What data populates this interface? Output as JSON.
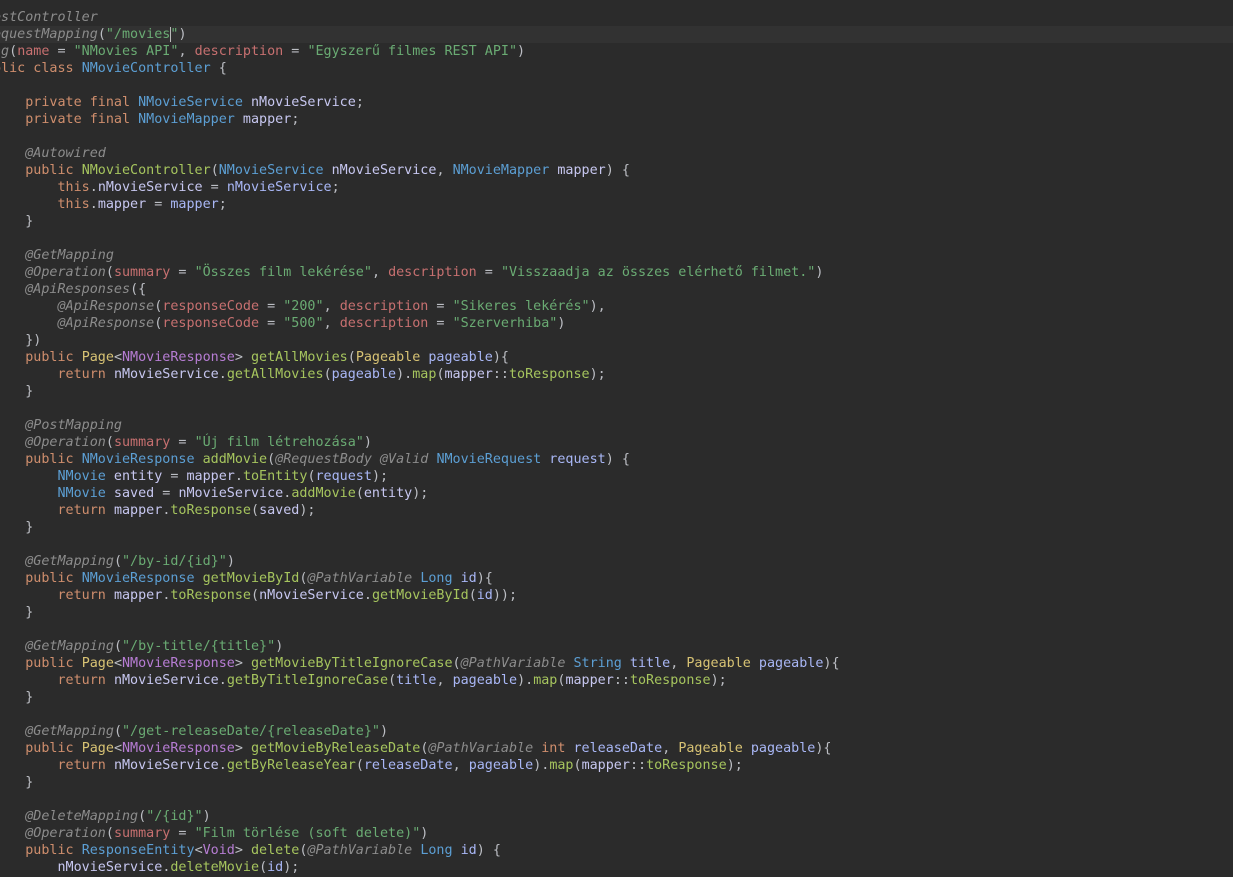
{
  "editor": {
    "language": "java",
    "cursor_line": 2,
    "cursor_col": 22,
    "lines": [
      [
        [
          "ann",
          "estController"
        ]
      ],
      [
        [
          "ann",
          "equestMapping"
        ],
        [
          "punc",
          "("
        ],
        [
          "str",
          "\"/movies\""
        ],
        [
          "punc",
          ")"
        ]
      ],
      [
        [
          "ann",
          "ag"
        ],
        [
          "punc",
          "("
        ],
        [
          "attr",
          "name"
        ],
        [
          "punc",
          " = "
        ],
        [
          "str",
          "\"NMovies API\""
        ],
        [
          "punc",
          ", "
        ],
        [
          "attr",
          "description"
        ],
        [
          "punc",
          " = "
        ],
        [
          "str",
          "\"Egyszerű filmes REST API\""
        ],
        [
          "punc",
          ")"
        ]
      ],
      [
        [
          "kw",
          "blic class "
        ],
        [
          "cls",
          "NMovieController"
        ],
        [
          "punc",
          " {"
        ]
      ],
      [],
      [
        [
          "kw",
          "    private final "
        ],
        [
          "cls",
          "NMovieService"
        ],
        [
          "id",
          " nMovieService"
        ],
        [
          "punc",
          ";"
        ]
      ],
      [
        [
          "kw",
          "    private final "
        ],
        [
          "cls",
          "NMovieMapper"
        ],
        [
          "id",
          " mapper"
        ],
        [
          "punc",
          ";"
        ]
      ],
      [],
      [
        [
          "ann",
          "    @Autowired"
        ]
      ],
      [
        [
          "kw",
          "    public "
        ],
        [
          "call",
          "NMovieController"
        ],
        [
          "punc",
          "("
        ],
        [
          "cls",
          "NMovieService"
        ],
        [
          "id",
          " nMovieService"
        ],
        [
          "punc",
          ", "
        ],
        [
          "cls",
          "NMovieMapper"
        ],
        [
          "id",
          " mapper"
        ],
        [
          "punc",
          ") {"
        ]
      ],
      [
        [
          "kw",
          "        this"
        ],
        [
          "punc",
          "."
        ],
        [
          "id",
          "nMovieService"
        ],
        [
          "punc",
          " = "
        ],
        [
          "param",
          "nMovieService"
        ],
        [
          "punc",
          ";"
        ]
      ],
      [
        [
          "kw",
          "        this"
        ],
        [
          "punc",
          "."
        ],
        [
          "id",
          "mapper"
        ],
        [
          "punc",
          " = "
        ],
        [
          "param",
          "mapper"
        ],
        [
          "punc",
          ";"
        ]
      ],
      [
        [
          "punc",
          "    }"
        ]
      ],
      [],
      [
        [
          "ann",
          "    @GetMapping"
        ]
      ],
      [
        [
          "ann",
          "    @Operation"
        ],
        [
          "punc",
          "("
        ],
        [
          "attr",
          "summary"
        ],
        [
          "punc",
          " = "
        ],
        [
          "str",
          "\"Összes film lekérése\""
        ],
        [
          "punc",
          ", "
        ],
        [
          "attr",
          "description"
        ],
        [
          "punc",
          " = "
        ],
        [
          "str",
          "\"Visszaadja az összes elérhető filmet.\""
        ],
        [
          "punc",
          ")"
        ]
      ],
      [
        [
          "ann",
          "    @ApiResponses"
        ],
        [
          "punc",
          "({"
        ]
      ],
      [
        [
          "ann",
          "        @ApiResponse"
        ],
        [
          "punc",
          "("
        ],
        [
          "attr",
          "responseCode"
        ],
        [
          "punc",
          " = "
        ],
        [
          "str",
          "\"200\""
        ],
        [
          "punc",
          ", "
        ],
        [
          "attr",
          "description"
        ],
        [
          "punc",
          " = "
        ],
        [
          "str",
          "\"Sikeres lekérés\""
        ],
        [
          "punc",
          "),"
        ]
      ],
      [
        [
          "ann",
          "        @ApiResponse"
        ],
        [
          "punc",
          "("
        ],
        [
          "attr",
          "responseCode"
        ],
        [
          "punc",
          " = "
        ],
        [
          "str",
          "\"500\""
        ],
        [
          "punc",
          ", "
        ],
        [
          "attr",
          "description"
        ],
        [
          "punc",
          " = "
        ],
        [
          "str",
          "\"Szerverhiba\""
        ],
        [
          "punc",
          ")"
        ]
      ],
      [
        [
          "punc",
          "    })"
        ]
      ],
      [
        [
          "kw",
          "    public "
        ],
        [
          "plain",
          "Page"
        ],
        [
          "punc",
          "<"
        ],
        [
          "gen",
          "NMovieResponse"
        ],
        [
          "punc",
          "> "
        ],
        [
          "call",
          "getAllMovies"
        ],
        [
          "punc",
          "("
        ],
        [
          "plain",
          "Pageable"
        ],
        [
          "param",
          " pageable"
        ],
        [
          "punc",
          "){"
        ]
      ],
      [
        [
          "kw",
          "        return "
        ],
        [
          "id",
          "nMovieService"
        ],
        [
          "punc",
          "."
        ],
        [
          "call",
          "getAllMovies"
        ],
        [
          "punc",
          "("
        ],
        [
          "param",
          "pageable"
        ],
        [
          "punc",
          ")."
        ],
        [
          "call",
          "map"
        ],
        [
          "punc",
          "("
        ],
        [
          "id",
          "mapper"
        ],
        [
          "punc",
          "::"
        ],
        [
          "call",
          "toResponse"
        ],
        [
          "punc",
          ");"
        ]
      ],
      [
        [
          "punc",
          "    }"
        ]
      ],
      [],
      [
        [
          "ann",
          "    @PostMapping"
        ]
      ],
      [
        [
          "ann",
          "    @Operation"
        ],
        [
          "punc",
          "("
        ],
        [
          "attr",
          "summary"
        ],
        [
          "punc",
          " = "
        ],
        [
          "str",
          "\"Új film létrehozása\""
        ],
        [
          "punc",
          ")"
        ]
      ],
      [
        [
          "kw",
          "    public "
        ],
        [
          "cls",
          "NMovieResponse"
        ],
        [
          "call",
          " addMovie"
        ],
        [
          "punc",
          "("
        ],
        [
          "ann",
          "@RequestBody @Valid "
        ],
        [
          "cls",
          "NMovieRequest"
        ],
        [
          "param",
          " request"
        ],
        [
          "punc",
          ") {"
        ]
      ],
      [
        [
          "cls",
          "        NMovie"
        ],
        [
          "id",
          " entity"
        ],
        [
          "punc",
          " = "
        ],
        [
          "id",
          "mapper"
        ],
        [
          "punc",
          "."
        ],
        [
          "call",
          "toEntity"
        ],
        [
          "punc",
          "("
        ],
        [
          "param",
          "request"
        ],
        [
          "punc",
          ");"
        ]
      ],
      [
        [
          "cls",
          "        NMovie"
        ],
        [
          "id",
          " saved"
        ],
        [
          "punc",
          " = "
        ],
        [
          "id",
          "nMovieService"
        ],
        [
          "punc",
          "."
        ],
        [
          "call",
          "addMovie"
        ],
        [
          "punc",
          "("
        ],
        [
          "id",
          "entity"
        ],
        [
          "punc",
          ");"
        ]
      ],
      [
        [
          "kw",
          "        return "
        ],
        [
          "id",
          "mapper"
        ],
        [
          "punc",
          "."
        ],
        [
          "call",
          "toResponse"
        ],
        [
          "punc",
          "("
        ],
        [
          "id",
          "saved"
        ],
        [
          "punc",
          ");"
        ]
      ],
      [
        [
          "punc",
          "    }"
        ]
      ],
      [],
      [
        [
          "ann",
          "    @GetMapping"
        ],
        [
          "punc",
          "("
        ],
        [
          "str",
          "\"/by-id/{id}\""
        ],
        [
          "punc",
          ")"
        ]
      ],
      [
        [
          "kw",
          "    public "
        ],
        [
          "cls",
          "NMovieResponse"
        ],
        [
          "call",
          " getMovieById"
        ],
        [
          "punc",
          "("
        ],
        [
          "ann",
          "@PathVariable "
        ],
        [
          "cls",
          "Long"
        ],
        [
          "param",
          " id"
        ],
        [
          "punc",
          "){"
        ]
      ],
      [
        [
          "kw",
          "        return "
        ],
        [
          "id",
          "mapper"
        ],
        [
          "punc",
          "."
        ],
        [
          "call",
          "toResponse"
        ],
        [
          "punc",
          "("
        ],
        [
          "id",
          "nMovieService"
        ],
        [
          "punc",
          "."
        ],
        [
          "call",
          "getMovieById"
        ],
        [
          "punc",
          "("
        ],
        [
          "param",
          "id"
        ],
        [
          "punc",
          "));"
        ]
      ],
      [
        [
          "punc",
          "    }"
        ]
      ],
      [],
      [
        [
          "ann",
          "    @GetMapping"
        ],
        [
          "punc",
          "("
        ],
        [
          "str",
          "\"/by-title/{title}\""
        ],
        [
          "punc",
          ")"
        ]
      ],
      [
        [
          "kw",
          "    public "
        ],
        [
          "plain",
          "Page"
        ],
        [
          "punc",
          "<"
        ],
        [
          "gen",
          "NMovieResponse"
        ],
        [
          "punc",
          "> "
        ],
        [
          "call",
          "getMovieByTitleIgnoreCase"
        ],
        [
          "punc",
          "("
        ],
        [
          "ann",
          "@PathVariable "
        ],
        [
          "cls",
          "String"
        ],
        [
          "param",
          " title"
        ],
        [
          "punc",
          ", "
        ],
        [
          "plain",
          "Pageable"
        ],
        [
          "param",
          " pageable"
        ],
        [
          "punc",
          "){"
        ]
      ],
      [
        [
          "kw",
          "        return "
        ],
        [
          "id",
          "nMovieService"
        ],
        [
          "punc",
          "."
        ],
        [
          "call",
          "getByTitleIgnoreCase"
        ],
        [
          "punc",
          "("
        ],
        [
          "param",
          "title"
        ],
        [
          "punc",
          ", "
        ],
        [
          "param",
          "pageable"
        ],
        [
          "punc",
          ")."
        ],
        [
          "call",
          "map"
        ],
        [
          "punc",
          "("
        ],
        [
          "id",
          "mapper"
        ],
        [
          "punc",
          "::"
        ],
        [
          "call",
          "toResponse"
        ],
        [
          "punc",
          ");"
        ]
      ],
      [
        [
          "punc",
          "    }"
        ]
      ],
      [],
      [
        [
          "ann",
          "    @GetMapping"
        ],
        [
          "punc",
          "("
        ],
        [
          "str",
          "\"/get-releaseDate/{releaseDate}\""
        ],
        [
          "punc",
          ")"
        ]
      ],
      [
        [
          "kw",
          "    public "
        ],
        [
          "plain",
          "Page"
        ],
        [
          "punc",
          "<"
        ],
        [
          "gen",
          "NMovieResponse"
        ],
        [
          "punc",
          "> "
        ],
        [
          "call",
          "getMovieByReleaseDate"
        ],
        [
          "punc",
          "("
        ],
        [
          "ann",
          "@PathVariable "
        ],
        [
          "kw",
          "int"
        ],
        [
          "param",
          " releaseDate"
        ],
        [
          "punc",
          ", "
        ],
        [
          "plain",
          "Pageable"
        ],
        [
          "param",
          " pageable"
        ],
        [
          "punc",
          "){"
        ]
      ],
      [
        [
          "kw",
          "        return "
        ],
        [
          "id",
          "nMovieService"
        ],
        [
          "punc",
          "."
        ],
        [
          "call",
          "getByReleaseYear"
        ],
        [
          "punc",
          "("
        ],
        [
          "param",
          "releaseDate"
        ],
        [
          "punc",
          ", "
        ],
        [
          "param",
          "pageable"
        ],
        [
          "punc",
          ")."
        ],
        [
          "call",
          "map"
        ],
        [
          "punc",
          "("
        ],
        [
          "id",
          "mapper"
        ],
        [
          "punc",
          "::"
        ],
        [
          "call",
          "toResponse"
        ],
        [
          "punc",
          ");"
        ]
      ],
      [
        [
          "punc",
          "    }"
        ]
      ],
      [],
      [
        [
          "ann",
          "    @DeleteMapping"
        ],
        [
          "punc",
          "("
        ],
        [
          "str",
          "\"/{id}\""
        ],
        [
          "punc",
          ")"
        ]
      ],
      [
        [
          "ann",
          "    @Operation"
        ],
        [
          "punc",
          "("
        ],
        [
          "attr",
          "summary"
        ],
        [
          "punc",
          " = "
        ],
        [
          "str",
          "\"Film törlése (soft delete)\""
        ],
        [
          "punc",
          ")"
        ]
      ],
      [
        [
          "kw",
          "    public "
        ],
        [
          "cls",
          "ResponseEntity"
        ],
        [
          "punc",
          "<"
        ],
        [
          "gen",
          "Void"
        ],
        [
          "punc",
          "> "
        ],
        [
          "call",
          "delete"
        ],
        [
          "punc",
          "("
        ],
        [
          "ann",
          "@PathVariable "
        ],
        [
          "cls",
          "Long"
        ],
        [
          "param",
          " id"
        ],
        [
          "punc",
          ") {"
        ]
      ],
      [
        [
          "id",
          "        nMovieService"
        ],
        [
          "punc",
          "."
        ],
        [
          "call",
          "deleteMovie"
        ],
        [
          "punc",
          "("
        ],
        [
          "param",
          "id"
        ],
        [
          "punc",
          ");"
        ]
      ]
    ]
  }
}
